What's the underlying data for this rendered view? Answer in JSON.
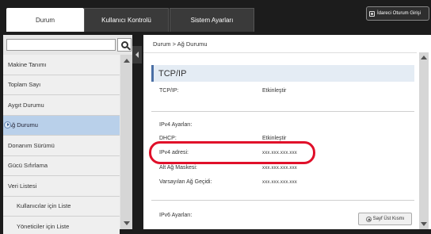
{
  "tabs": [
    {
      "label": "Durum",
      "active": true
    },
    {
      "label": "Kullanıcı Kontrolü",
      "active": false
    },
    {
      "label": "Sistem Ayarları",
      "active": false
    }
  ],
  "admin_button": {
    "label": "İdareci Oturum Girişi",
    "icon": "login-icon"
  },
  "search": {
    "value": "",
    "placeholder": ""
  },
  "sidebar": {
    "items": [
      {
        "label": "Makine Tanımı"
      },
      {
        "label": "Toplam Sayı"
      },
      {
        "label": "Aygıt Durumu"
      },
      {
        "label": "Ağ Durumu",
        "selected": true
      },
      {
        "label": "Donanım Sürümü"
      },
      {
        "label": "Gücü Sıfırlama"
      },
      {
        "label": "Veri Listesi"
      },
      {
        "label": "Kullanıcılar için Liste",
        "sub": true
      },
      {
        "label": "Yöneticiler için Liste",
        "sub": true
      }
    ]
  },
  "breadcrumb": "Durum >  Ağ Durumu",
  "section": {
    "title": "TCP/IP"
  },
  "tcpip": {
    "label": "TCP/IP:",
    "value": "Etkinleştir"
  },
  "ipv4": {
    "header": "IPv4 Ayarları:",
    "dhcp_label": "DHCP:",
    "dhcp_value": "Etkinleştir",
    "address_label": "IPv4 adresi:",
    "address_value": "xxx.xxx.xxx.xxx",
    "mask_label": "Alt Ağ Maskesi:",
    "mask_value": "xxx.xxx.xxx.xxx",
    "gateway_label": "Varsayılan Ağ Geçidi:",
    "gateway_value": "xxx.xxx.xxx.xxx"
  },
  "ipv6": {
    "header": "IPv6 Ayarları:"
  },
  "page_top_button": "Sayf Üst Kısmı",
  "colors": {
    "accent": "#4a6fa5",
    "highlight": "#e0102a",
    "selected": "#b9d0ea"
  }
}
